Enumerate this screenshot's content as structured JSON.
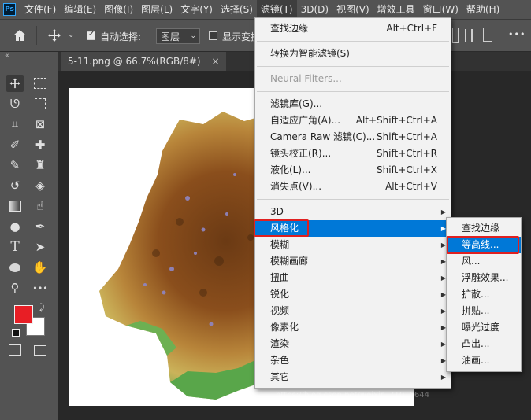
{
  "app": {
    "logo": "Ps"
  },
  "menubar": {
    "items": [
      "文件(F)",
      "编辑(E)",
      "图像(I)",
      "图层(L)",
      "文字(Y)",
      "选择(S)",
      "滤镜(T)",
      "3D(D)",
      "视图(V)",
      "增效工具",
      "窗口(W)",
      "帮助(H)"
    ],
    "active_index": 6
  },
  "options": {
    "auto_select_label": "自动选择:",
    "layer_select_value": "图层",
    "show_transform_label": "显示变换控件",
    "more_label": "•••"
  },
  "document_tab": {
    "title": "5-11.png @ 66.7%(RGB/8#)",
    "close": "×"
  },
  "filter_menu": {
    "items": [
      {
        "label": "查找边缘",
        "shortcut": "Alt+Ctrl+F"
      },
      {
        "sep": true
      },
      {
        "label": "转换为智能滤镜(S)"
      },
      {
        "sep": true
      },
      {
        "label": "Neural Filters...",
        "disabled": true
      },
      {
        "sep": true
      },
      {
        "label": "滤镜库(G)..."
      },
      {
        "label": "自适应广角(A)...",
        "shortcut": "Alt+Shift+Ctrl+A"
      },
      {
        "label": "Camera Raw 滤镜(C)...",
        "shortcut": "Shift+Ctrl+A"
      },
      {
        "label": "镜头校正(R)...",
        "shortcut": "Shift+Ctrl+R"
      },
      {
        "label": "液化(L)...",
        "shortcut": "Shift+Ctrl+X"
      },
      {
        "label": "消失点(V)...",
        "shortcut": "Alt+Ctrl+V"
      },
      {
        "sep": true
      },
      {
        "label": "3D",
        "submenu": true
      },
      {
        "label": "风格化",
        "submenu": true,
        "highlighted": true
      },
      {
        "label": "模糊",
        "submenu": true
      },
      {
        "label": "模糊画廊",
        "submenu": true
      },
      {
        "label": "扭曲",
        "submenu": true
      },
      {
        "label": "锐化",
        "submenu": true
      },
      {
        "label": "视频",
        "submenu": true
      },
      {
        "label": "像素化",
        "submenu": true
      },
      {
        "label": "渲染",
        "submenu": true
      },
      {
        "label": "杂色",
        "submenu": true
      },
      {
        "label": "其它",
        "submenu": true
      }
    ]
  },
  "stylize_submenu": {
    "items": [
      {
        "label": "查找边缘"
      },
      {
        "label": "等高线...",
        "highlighted": true
      },
      {
        "label": "风..."
      },
      {
        "label": "浮雕效果..."
      },
      {
        "label": "扩散..."
      },
      {
        "label": "拼贴..."
      },
      {
        "label": "曝光过度"
      },
      {
        "label": "凸出..."
      },
      {
        "label": "油画..."
      }
    ]
  },
  "colors": {
    "foreground": "#e81e25",
    "background": "#ffffff",
    "highlight": "#0078d7",
    "annotation": "#e02020"
  },
  "watermark": "https://blog.csdn.net/weixin_71016644"
}
